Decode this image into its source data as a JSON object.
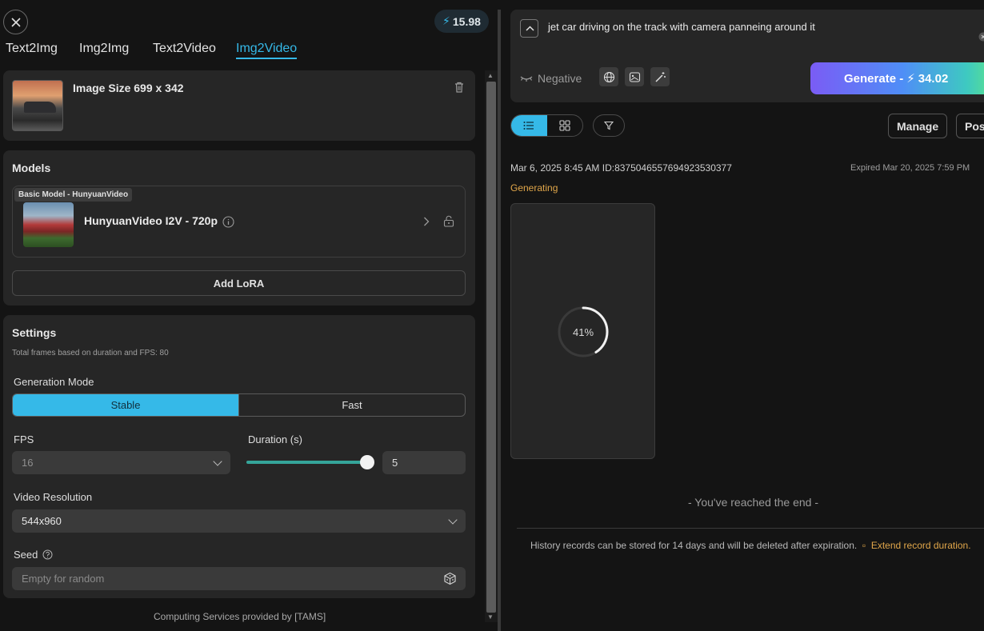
{
  "credits": {
    "balance": "15.98"
  },
  "tabs": [
    {
      "label": "Text2Img"
    },
    {
      "label": "Img2Img"
    },
    {
      "label": "Text2Video"
    },
    {
      "label": "Img2Video",
      "active": true
    }
  ],
  "image_card": {
    "title": "Image Size 699 x 342"
  },
  "models": {
    "title": "Models",
    "tag": "Basic Model - HunyuanVideo",
    "name": "HunyuanVideo I2V - 720p",
    "add_lora": "Add LoRA"
  },
  "settings": {
    "title": "Settings",
    "note": "Total frames based on duration and FPS: 80",
    "generation_mode_label": "Generation Mode",
    "modes": [
      "Stable",
      "Fast"
    ],
    "selected_mode": "Stable",
    "fps_label": "FPS",
    "fps_value": "16",
    "duration_label": "Duration (s)",
    "duration_value": "5",
    "duration_slider_fraction": 1.0,
    "resolution_label": "Video Resolution",
    "resolution_value": "544x960",
    "seed_label": "Seed",
    "seed_placeholder": "Empty for random"
  },
  "footer": {
    "text": "Computing Services provided by [TAMS]"
  },
  "prompt": {
    "text": "jet car driving on the track with camera panneing around it",
    "negative_label": "Negative",
    "generate_label": "Generate -",
    "generate_cost": "34.02"
  },
  "toolbar": {
    "manage_label": "Manage",
    "post_label": "Post"
  },
  "record": {
    "meta": "Mar 6, 2025 8:45 AM ID:837504655769492353037​7",
    "expiry": "Expired Mar 20, 2025 7:59 PM",
    "status": "Generating",
    "progress_percent": 41,
    "progress_label": "41%"
  },
  "end_text": "- You've reached the end -",
  "history": {
    "note": "History records can be stored for 14 days and will be deleted after expiration.",
    "link": "Extend record duration."
  },
  "colors": {
    "accent": "#35b9e8",
    "warning": "#e0a64a",
    "background": "#141414",
    "card": "#262626"
  }
}
